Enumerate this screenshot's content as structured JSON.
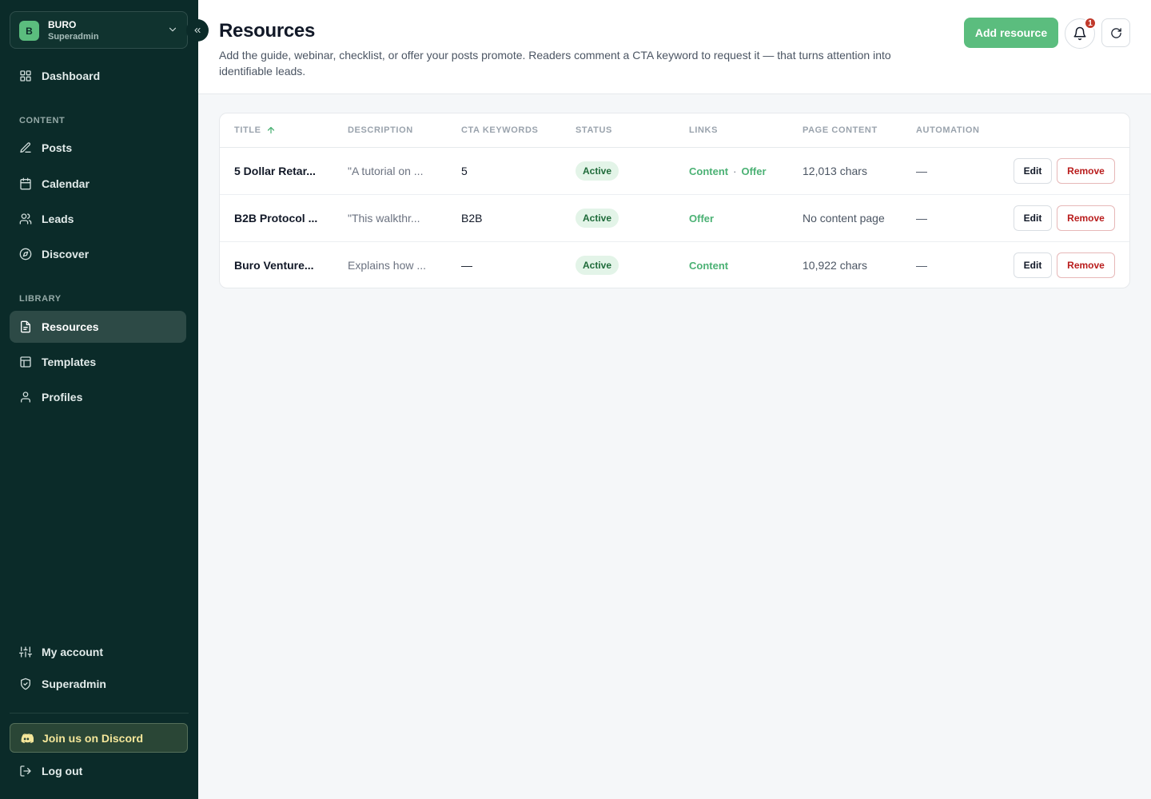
{
  "workspace": {
    "initial": "B",
    "name": "BURO",
    "role": "Superadmin"
  },
  "nav": {
    "dashboard": "Dashboard",
    "content_label": "CONTENT",
    "posts": "Posts",
    "calendar": "Calendar",
    "leads": "Leads",
    "discover": "Discover",
    "library_label": "LIBRARY",
    "resources": "Resources",
    "templates": "Templates",
    "profiles": "Profiles",
    "my_account": "My account",
    "superadmin": "Superadmin",
    "discord": "Join us on Discord",
    "logout": "Log out"
  },
  "header": {
    "title": "Resources",
    "description": "Add the guide, webinar, checklist, or offer your posts promote. Readers comment a CTA keyword to request it — that turns attention into identifiable leads.",
    "add_button": "Add resource",
    "notification_count": "1"
  },
  "table": {
    "columns": [
      "TITLE",
      "DESCRIPTION",
      "CTA KEYWORDS",
      "STATUS",
      "LINKS",
      "PAGE CONTENT",
      "AUTOMATION"
    ],
    "sort_column": "TITLE",
    "edit_label": "Edit",
    "remove_label": "Remove",
    "rows": [
      {
        "title": "5 Dollar Retar...",
        "description": "\"A tutorial on ...",
        "cta": "5",
        "status": "Active",
        "links": [
          "Content",
          "Offer"
        ],
        "page_content": "12,013 chars",
        "automation": "—"
      },
      {
        "title": "B2B Protocol ...",
        "description": "\"This walkthr...",
        "cta": "B2B",
        "status": "Active",
        "links": [
          "Offer"
        ],
        "page_content": "No content page",
        "automation": "—"
      },
      {
        "title": "Buro Venture...",
        "description": "Explains how ...",
        "cta": "—",
        "status": "Active",
        "links": [
          "Content"
        ],
        "page_content": "10,922 chars",
        "automation": "—"
      }
    ]
  },
  "colors": {
    "sidebar": "#0b2b29",
    "accent": "#5bbd7e",
    "danger": "#b91c1c"
  }
}
